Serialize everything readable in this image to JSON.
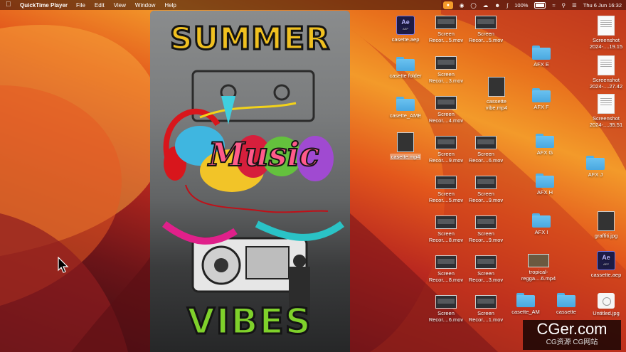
{
  "menubar": {
    "app_name": "QuickTime Player",
    "menus": [
      "File",
      "Edit",
      "View",
      "Window",
      "Help"
    ],
    "battery_percent": "100%",
    "datetime": "Thu 6 Jun  16:32"
  },
  "player": {
    "title_top": "SUMMER",
    "title_mid": "Music",
    "title_bottom": "VIBES"
  },
  "desktop_icons": [
    {
      "label": "casette.aep",
      "type": "ae"
    },
    {
      "label": "Screen\nRecor....5.mov",
      "type": "mov"
    },
    {
      "label": "Screen\nRecor....5.mov",
      "type": "mov"
    },
    {
      "label": "Screenshot\n2024-....19.15",
      "type": "doc"
    },
    {
      "label": "AFX E",
      "type": "folder"
    },
    {
      "label": "casette folder",
      "type": "folder"
    },
    {
      "label": "Screen\nRecor....3.mov",
      "type": "mov"
    },
    {
      "label": "Screenshot\n2024-....27.42",
      "type": "doc"
    },
    {
      "label": "cassette\nvibe.mp4",
      "type": "vid"
    },
    {
      "label": "AFX F",
      "type": "folder"
    },
    {
      "label": "casette_AME",
      "type": "folder"
    },
    {
      "label": "Screen\nRecor....4.mov",
      "type": "mov"
    },
    {
      "label": "Screenshot\n2024-....35.51",
      "type": "doc"
    },
    {
      "label": "casette.mp4",
      "type": "vid"
    },
    {
      "label": "Screen\nRecor....9.mov",
      "type": "mov"
    },
    {
      "label": "Screen\nRecor....6.mov",
      "type": "mov"
    },
    {
      "label": "AFX G",
      "type": "folder"
    },
    {
      "label": "AFX J",
      "type": "folder"
    },
    {
      "label": "AFX H",
      "type": "folder"
    },
    {
      "label": "Screen\nRecor....5.mov",
      "type": "mov"
    },
    {
      "label": "Screen\nRecor....9.mov",
      "type": "mov"
    },
    {
      "label": "AFX I",
      "type": "folder"
    },
    {
      "label": "graffiti.jpg",
      "type": "vid"
    },
    {
      "label": "Screen\nRecor....8.mov",
      "type": "mov"
    },
    {
      "label": "Screen\nRecor....9.mov",
      "type": "mov"
    },
    {
      "label": "cassette.aep",
      "type": "ae"
    },
    {
      "label": "tropical-\nregga....6.mp4",
      "type": "wide"
    },
    {
      "label": "Screen\nRecor....8.mov",
      "type": "mov"
    },
    {
      "label": "Screen\nRecor....3.mov",
      "type": "mov"
    },
    {
      "label": "casette_AM",
      "type": "folder"
    },
    {
      "label": "cassette",
      "type": "folder"
    },
    {
      "label": "Untitled.jpg",
      "type": "circ"
    },
    {
      "label": "Screen\nRecor....6.mov",
      "type": "mov"
    },
    {
      "label": "Screen\nRecor....1.mov",
      "type": "mov"
    }
  ],
  "watermark": {
    "line1": "CGer.com",
    "line2": "CG资源 CG网站"
  },
  "colors": {
    "accent_orange": "#f39a2a",
    "folder_blue": "#5ab4ea"
  }
}
